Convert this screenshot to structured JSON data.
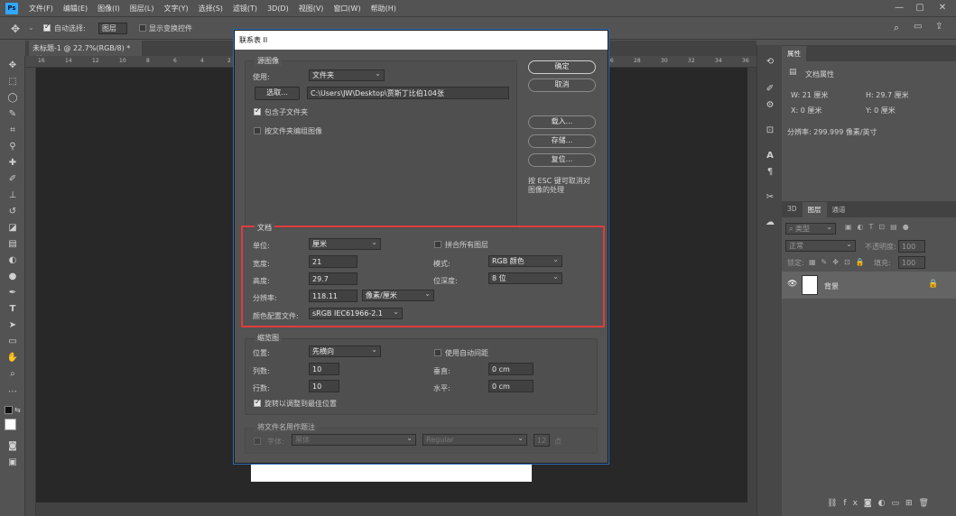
{
  "menubar": {
    "logo": "Ps",
    "items": [
      "文件(F)",
      "编辑(E)",
      "图像(I)",
      "图层(L)",
      "文字(Y)",
      "选择(S)",
      "滤镜(T)",
      "3D(D)",
      "视图(V)",
      "窗口(W)",
      "帮助(H)"
    ]
  },
  "options": {
    "auto_select": "自动选择:",
    "auto_select_value": "图层",
    "show_transform": "显示变换控件"
  },
  "doc_tab": "未标题-1 @ 22.7%(RGB/8) *",
  "ruler_ticks": [
    "16",
    "14",
    "12",
    "10",
    "8",
    "6",
    "4",
    "2",
    "0",
    "2",
    "4",
    "6",
    "8",
    "10",
    "12",
    "14",
    "16",
    "18",
    "20",
    "22",
    "24",
    "26",
    "28",
    "30",
    "32",
    "34",
    "36"
  ],
  "dialog": {
    "title": "联系表 II",
    "source_group": "源图像",
    "use_label": "使用:",
    "use_value": "文件夹",
    "choose_btn": "选取...",
    "path": "C:\\Users\\JW\\Desktop\\贾斯丁比伯104张",
    "include_subfolders": "包含子文件夹",
    "group_by_folder": "按文件夹编组图像",
    "doc_group": "文档",
    "unit_label": "单位:",
    "unit_value": "厘米",
    "flatten_label": "拼合所有图层",
    "width_label": "宽度:",
    "width_value": "21",
    "mode_label": "模式:",
    "mode_value": "RGB 颜色",
    "height_label": "高度:",
    "height_value": "29.7",
    "depth_label": "位深度:",
    "depth_value": "8 位",
    "res_label": "分辨率:",
    "res_value": "118.11",
    "res_unit": "像素/厘米",
    "profile_label": "颜色配置文件:",
    "profile_value": "sRGB IEC61966-2.1",
    "thumb_group": "缩览图",
    "place_label": "位置:",
    "place_value": "先横向",
    "auto_space": "使用自动间距",
    "cols_label": "列数:",
    "cols_value": "10",
    "vert_label": "垂直:",
    "vert_value": "0 cm",
    "rows_label": "行数:",
    "rows_value": "10",
    "horiz_label": "水平:",
    "horiz_value": "0 cm",
    "rotate_label": "旋转以调整到最佳位置",
    "caption_group": "将文件名用作题注",
    "font_label": "字体:",
    "font_value": "黑体",
    "style_value": "Regular",
    "size_value": "12",
    "size_unit": "点",
    "ok": "确定",
    "cancel": "取消",
    "load": "载入...",
    "save": "存储...",
    "reset": "复位...",
    "hint": "按 ESC 键可取消对图像的处理"
  },
  "properties": {
    "tab": "属性",
    "title": "文档属性",
    "w": "W:  21 厘米",
    "h": "H:  29.7 厘米",
    "x": "X:  0 厘米",
    "y": "Y:  0 厘米",
    "res": "分辨率: 299.999 像素/英寸"
  },
  "layers": {
    "tabs": [
      "3D",
      "图层",
      "通道"
    ],
    "kind": "类型",
    "blend": "正常",
    "opacity": "不透明度:",
    "opacity_val": "100",
    "lock": "锁定:",
    "fill": "填充:",
    "fill_val": "100",
    "layer_name": "背景"
  }
}
